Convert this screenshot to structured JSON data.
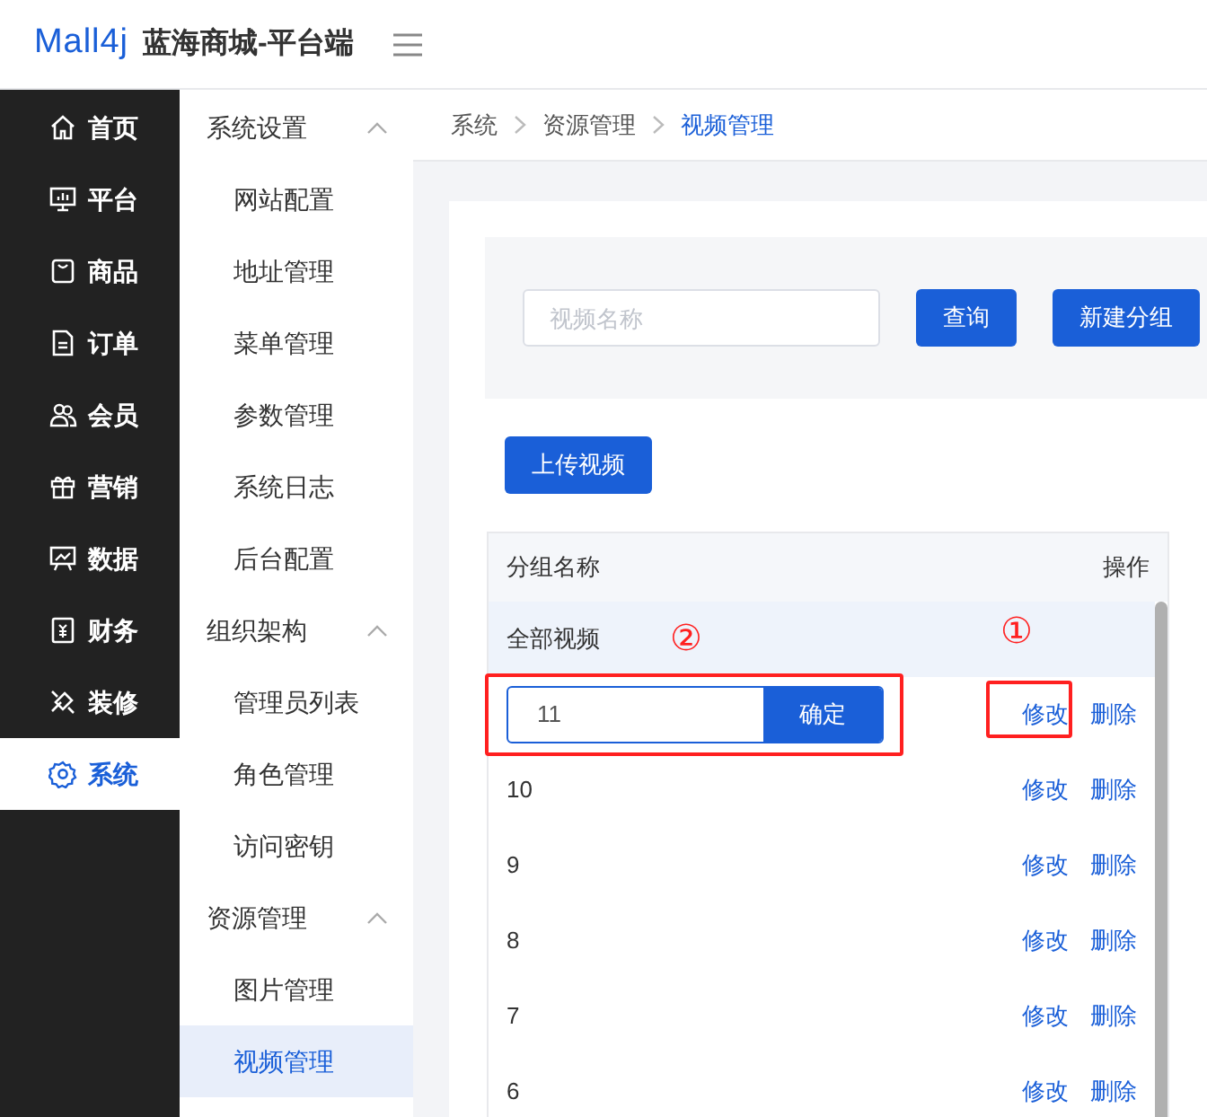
{
  "header": {
    "logo": "Mall4j",
    "title": "蓝海商城-平台端"
  },
  "main_nav": [
    {
      "label": "首页",
      "selected": false
    },
    {
      "label": "平台",
      "selected": false
    },
    {
      "label": "商品",
      "selected": false
    },
    {
      "label": "订单",
      "selected": false
    },
    {
      "label": "会员",
      "selected": false
    },
    {
      "label": "营销",
      "selected": false
    },
    {
      "label": "数据",
      "selected": false
    },
    {
      "label": "财务",
      "selected": false
    },
    {
      "label": "装修",
      "selected": false
    },
    {
      "label": "系统",
      "selected": true
    }
  ],
  "sub_nav": [
    {
      "label": "系统设置",
      "expanded": true,
      "children": [
        {
          "label": "网站配置",
          "selected": false
        },
        {
          "label": "地址管理",
          "selected": false
        },
        {
          "label": "菜单管理",
          "selected": false
        },
        {
          "label": "参数管理",
          "selected": false
        },
        {
          "label": "系统日志",
          "selected": false
        },
        {
          "label": "后台配置",
          "selected": false
        }
      ]
    },
    {
      "label": "组织架构",
      "expanded": true,
      "children": [
        {
          "label": "管理员列表",
          "selected": false
        },
        {
          "label": "角色管理",
          "selected": false
        },
        {
          "label": "访问密钥",
          "selected": false
        }
      ]
    },
    {
      "label": "资源管理",
      "expanded": true,
      "children": [
        {
          "label": "图片管理",
          "selected": false
        },
        {
          "label": "视频管理",
          "selected": true
        }
      ]
    }
  ],
  "breadcrumb": [
    "系统",
    "资源管理",
    "视频管理"
  ],
  "search": {
    "placeholder": "视频名称",
    "buttons": [
      "查询",
      "新建分组"
    ]
  },
  "upload_button": "上传视频",
  "table": {
    "columns": [
      "分组名称",
      "操作"
    ],
    "rows": [
      {
        "name": "全部视频",
        "selected": true,
        "editing": false
      },
      {
        "name": "11",
        "selected": false,
        "editing": true,
        "confirm": "确定",
        "actions": [
          "修改",
          "删除"
        ]
      },
      {
        "name": "10",
        "selected": false,
        "editing": false,
        "actions": [
          "修改",
          "删除"
        ]
      },
      {
        "name": "9",
        "selected": false,
        "editing": false,
        "actions": [
          "修改",
          "删除"
        ]
      },
      {
        "name": "8",
        "selected": false,
        "editing": false,
        "actions": [
          "修改",
          "删除"
        ]
      },
      {
        "name": "7",
        "selected": false,
        "editing": false,
        "actions": [
          "修改",
          "删除"
        ]
      },
      {
        "name": "6",
        "selected": false,
        "editing": false,
        "actions": [
          "修改",
          "删除"
        ]
      }
    ]
  },
  "annotations": [
    "②",
    "①"
  ]
}
